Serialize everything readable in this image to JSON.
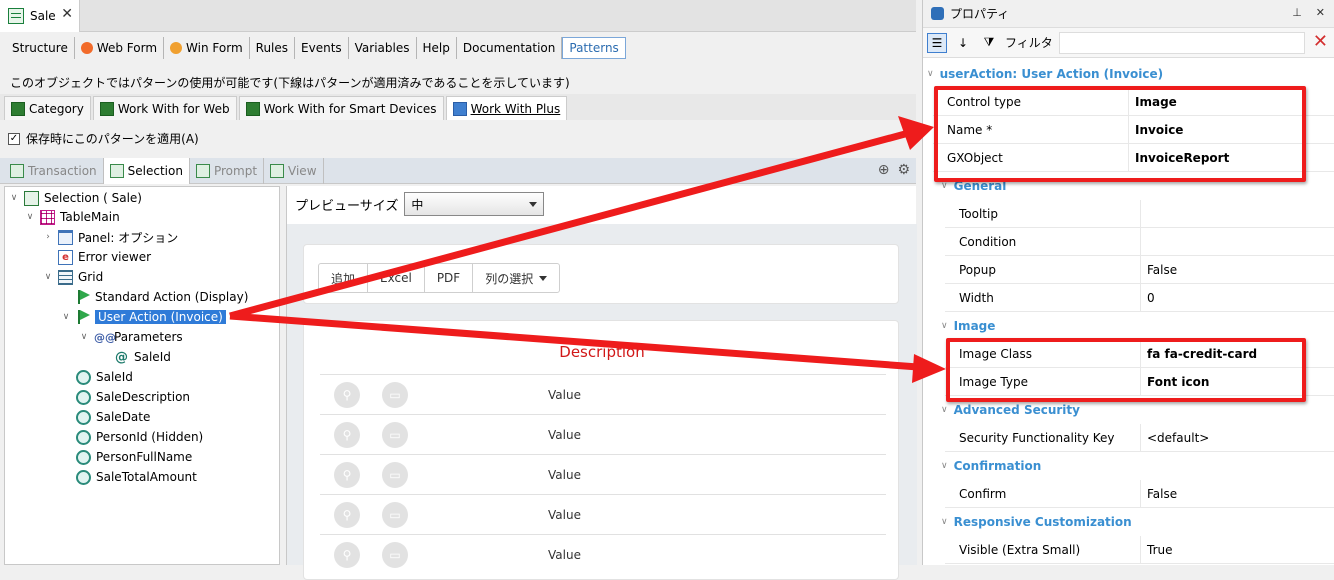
{
  "document_tab": {
    "label": "Sale",
    "close": "✕"
  },
  "menu": [
    {
      "label": "Structure",
      "icon": ""
    },
    {
      "label": "Web Form",
      "icon": "web-form-icon"
    },
    {
      "label": "Win Form",
      "icon": "win-form-icon"
    },
    {
      "label": "Rules",
      "icon": ""
    },
    {
      "label": "Events",
      "icon": ""
    },
    {
      "label": "Variables",
      "icon": ""
    },
    {
      "label": "Help",
      "icon": ""
    },
    {
      "label": "Documentation",
      "icon": ""
    },
    {
      "label": "Patterns",
      "icon": "",
      "active": true
    }
  ],
  "notice": "このオブジェクトではパターンの使用が可能です(下線はパターンが適用済みであることを示しています)",
  "pattern_tabs": [
    "Category",
    "Work With for Web",
    "Work With for Smart Devices",
    "Work With Plus"
  ],
  "apply_on_save": {
    "label": "保存時にこのパターンを適用(A)",
    "checked": "✓"
  },
  "sub_tabs": [
    "Transaction",
    "Selection",
    "Prompt",
    "View"
  ],
  "tree": {
    "selection": "Selection ( Sale)",
    "table_main": "TableMain",
    "panel": "Panel: オプション",
    "error_viewer": "Error viewer",
    "grid": "Grid",
    "standard_action": "Standard Action (Display)",
    "user_action": "User Action (Invoice)",
    "parameters": "Parameters",
    "param_saleid": "SaleId",
    "attrs": [
      "SaleId",
      "SaleDescription",
      "SaleDate",
      "PersonId (Hidden)",
      "PersonFullName",
      "SaleTotalAmount"
    ]
  },
  "preview": {
    "size_label": "プレビューサイズ",
    "size_value": "中",
    "buttons": [
      "追加",
      "Excel",
      "PDF",
      "列の選択"
    ],
    "column_header": "Description",
    "rows": [
      "Value",
      "Value",
      "Value",
      "Value",
      "Value"
    ]
  },
  "properties": {
    "title": "プロパティ",
    "filter_label": "フィルタ",
    "filter_value": "",
    "section_title": "userAction: User Action (Invoice)",
    "top_rows": [
      {
        "name": "Control type",
        "value": "Image"
      },
      {
        "name": "Name *",
        "value": "Invoice"
      },
      {
        "name": "GXObject",
        "value": "InvoiceReport"
      }
    ],
    "general": {
      "label": "General",
      "rows": [
        {
          "name": "Tooltip",
          "value": ""
        },
        {
          "name": "Condition",
          "value": ""
        },
        {
          "name": "Popup",
          "value": "False"
        },
        {
          "name": "Width",
          "value": "0"
        }
      ]
    },
    "image": {
      "label": "Image",
      "rows": [
        {
          "name": "Image Class",
          "value": "fa fa-credit-card"
        },
        {
          "name": "Image Type",
          "value": "Font icon"
        }
      ]
    },
    "advanced_security": {
      "label": "Advanced Security",
      "rows": [
        {
          "name": "Security Functionality Key",
          "value": "<default>"
        }
      ]
    },
    "confirmation": {
      "label": "Confirmation",
      "rows": [
        {
          "name": "Confirm",
          "value": "False"
        }
      ]
    },
    "responsive": {
      "label": "Responsive Customization",
      "rows": [
        {
          "name": "Visible (Extra Small)",
          "value": "True"
        }
      ]
    }
  },
  "colors": {
    "highlight": "#ee1c1c",
    "accent": "#3a8fd1",
    "selected": "#2f7bd8"
  }
}
